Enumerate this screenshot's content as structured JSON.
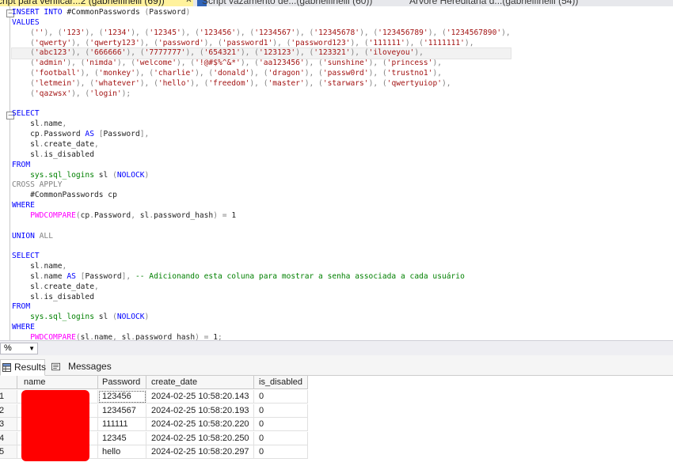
{
  "tabs": [
    {
      "label": "cript para verificar...2 (gabrielfinelli (69))",
      "close": "✕",
      "active": true
    },
    {
      "label": "Script vazamento de...(gabrielfinelli (60))",
      "active": false
    },
    {
      "label": "Árvore Hereditária d...(gabrielfinelli (54))",
      "active": false
    }
  ],
  "editor": {
    "lines": [
      [
        {
          "c": "kw",
          "t": "INSERT INTO "
        },
        {
          "c": "tx",
          "t": "#CommonPasswords "
        },
        {
          "c": "gray",
          "t": "("
        },
        {
          "c": "tx",
          "t": "Password"
        },
        {
          "c": "gray",
          "t": ")"
        }
      ],
      [
        {
          "c": "kw",
          "t": "VALUES"
        }
      ],
      [
        {
          "c": "gray",
          "t": "    ("
        },
        {
          "c": "str",
          "t": "''"
        },
        {
          "c": "gray",
          "t": "), ("
        },
        {
          "c": "str",
          "t": "'123'"
        },
        {
          "c": "gray",
          "t": "), ("
        },
        {
          "c": "str",
          "t": "'1234'"
        },
        {
          "c": "gray",
          "t": "), ("
        },
        {
          "c": "str",
          "t": "'12345'"
        },
        {
          "c": "gray",
          "t": "), ("
        },
        {
          "c": "str",
          "t": "'123456'"
        },
        {
          "c": "gray",
          "t": "), ("
        },
        {
          "c": "str",
          "t": "'1234567'"
        },
        {
          "c": "gray",
          "t": "), ("
        },
        {
          "c": "str",
          "t": "'12345678'"
        },
        {
          "c": "gray",
          "t": "), ("
        },
        {
          "c": "str",
          "t": "'123456789'"
        },
        {
          "c": "gray",
          "t": "), ("
        },
        {
          "c": "str",
          "t": "'1234567890'"
        },
        {
          "c": "gray",
          "t": "),"
        }
      ],
      [
        {
          "c": "gray",
          "t": "    ("
        },
        {
          "c": "str",
          "t": "'qwerty'"
        },
        {
          "c": "gray",
          "t": "), ("
        },
        {
          "c": "str",
          "t": "'qwerty123'"
        },
        {
          "c": "gray",
          "t": "), ("
        },
        {
          "c": "str",
          "t": "'password'"
        },
        {
          "c": "gray",
          "t": "), ("
        },
        {
          "c": "str",
          "t": "'password1'"
        },
        {
          "c": "gray",
          "t": "), ("
        },
        {
          "c": "str",
          "t": "'password123'"
        },
        {
          "c": "gray",
          "t": "), ("
        },
        {
          "c": "str",
          "t": "'111111'"
        },
        {
          "c": "gray",
          "t": "), ("
        },
        {
          "c": "str",
          "t": "'1111111'"
        },
        {
          "c": "gray",
          "t": "),"
        }
      ],
      [
        {
          "c": "gray",
          "t": "    ("
        },
        {
          "c": "str",
          "t": "'abc123'"
        },
        {
          "c": "gray",
          "t": "), ("
        },
        {
          "c": "str",
          "t": "'666666'"
        },
        {
          "c": "gray",
          "t": "), ("
        },
        {
          "c": "str",
          "t": "'7777777'"
        },
        {
          "c": "gray",
          "t": "), ("
        },
        {
          "c": "str",
          "t": "'654321'"
        },
        {
          "c": "gray",
          "t": "), ("
        },
        {
          "c": "str",
          "t": "'123123'"
        },
        {
          "c": "gray",
          "t": "), ("
        },
        {
          "c": "str",
          "t": "'123321'"
        },
        {
          "c": "gray",
          "t": "), ("
        },
        {
          "c": "str",
          "t": "'iloveyou'"
        },
        {
          "c": "gray",
          "t": "),"
        }
      ],
      [
        {
          "c": "gray",
          "t": "    ("
        },
        {
          "c": "str",
          "t": "'admin'"
        },
        {
          "c": "gray",
          "t": "), ("
        },
        {
          "c": "str",
          "t": "'nimda'"
        },
        {
          "c": "gray",
          "t": "), ("
        },
        {
          "c": "str",
          "t": "'welcome'"
        },
        {
          "c": "gray",
          "t": "), ("
        },
        {
          "c": "str",
          "t": "'!@#$%^&*'"
        },
        {
          "c": "gray",
          "t": "), ("
        },
        {
          "c": "str",
          "t": "'aa123456'"
        },
        {
          "c": "gray",
          "t": "), ("
        },
        {
          "c": "str",
          "t": "'sunshine'"
        },
        {
          "c": "gray",
          "t": "), ("
        },
        {
          "c": "str",
          "t": "'princess'"
        },
        {
          "c": "gray",
          "t": "),"
        }
      ],
      [
        {
          "c": "gray",
          "t": "    ("
        },
        {
          "c": "str",
          "t": "'football'"
        },
        {
          "c": "gray",
          "t": "), ("
        },
        {
          "c": "str",
          "t": "'monkey'"
        },
        {
          "c": "gray",
          "t": "), ("
        },
        {
          "c": "str",
          "t": "'charlie'"
        },
        {
          "c": "gray",
          "t": "), ("
        },
        {
          "c": "str",
          "t": "'donald'"
        },
        {
          "c": "gray",
          "t": "), ("
        },
        {
          "c": "str",
          "t": "'dragon'"
        },
        {
          "c": "gray",
          "t": "), ("
        },
        {
          "c": "str",
          "t": "'passw0rd'"
        },
        {
          "c": "gray",
          "t": "), ("
        },
        {
          "c": "str",
          "t": "'trustno1'"
        },
        {
          "c": "gray",
          "t": "),"
        }
      ],
      [
        {
          "c": "gray",
          "t": "    ("
        },
        {
          "c": "str",
          "t": "'letmein'"
        },
        {
          "c": "gray",
          "t": "), ("
        },
        {
          "c": "str",
          "t": "'whatever'"
        },
        {
          "c": "gray",
          "t": "), ("
        },
        {
          "c": "str",
          "t": "'hello'"
        },
        {
          "c": "gray",
          "t": "), ("
        },
        {
          "c": "str",
          "t": "'freedom'"
        },
        {
          "c": "gray",
          "t": "), ("
        },
        {
          "c": "str",
          "t": "'master'"
        },
        {
          "c": "gray",
          "t": "), ("
        },
        {
          "c": "str",
          "t": "'starwars'"
        },
        {
          "c": "gray",
          "t": "), ("
        },
        {
          "c": "str",
          "t": "'qwertyuiop'"
        },
        {
          "c": "gray",
          "t": "),"
        }
      ],
      [
        {
          "c": "gray",
          "t": "    ("
        },
        {
          "c": "str",
          "t": "'qazwsx'"
        },
        {
          "c": "gray",
          "t": "), ("
        },
        {
          "c": "str",
          "t": "'login'"
        },
        {
          "c": "gray",
          "t": ");"
        }
      ],
      [],
      [
        {
          "c": "kw",
          "t": "SELECT"
        }
      ],
      [
        {
          "c": "tx",
          "t": "    sl"
        },
        {
          "c": "gray",
          "t": "."
        },
        {
          "c": "tx",
          "t": "name"
        },
        {
          "c": "gray",
          "t": ","
        }
      ],
      [
        {
          "c": "tx",
          "t": "    cp"
        },
        {
          "c": "gray",
          "t": "."
        },
        {
          "c": "tx",
          "t": "Password "
        },
        {
          "c": "kw",
          "t": "AS "
        },
        {
          "c": "gray",
          "t": "["
        },
        {
          "c": "tx",
          "t": "Password"
        },
        {
          "c": "gray",
          "t": "],"
        }
      ],
      [
        {
          "c": "tx",
          "t": "    sl"
        },
        {
          "c": "gray",
          "t": "."
        },
        {
          "c": "tx",
          "t": "create_date"
        },
        {
          "c": "gray",
          "t": ","
        }
      ],
      [
        {
          "c": "tx",
          "t": "    sl"
        },
        {
          "c": "gray",
          "t": "."
        },
        {
          "c": "tx",
          "t": "is_disabled"
        }
      ],
      [
        {
          "c": "kw",
          "t": "FROM"
        }
      ],
      [
        {
          "c": "tx",
          "t": "    "
        },
        {
          "c": "cm",
          "t": "sys.sql_logins"
        },
        {
          "c": "tx",
          "t": " sl "
        },
        {
          "c": "gray",
          "t": "("
        },
        {
          "c": "kw",
          "t": "NOLOCK"
        },
        {
          "c": "gray",
          "t": ")"
        }
      ],
      [
        {
          "c": "gray",
          "t": "CROSS APPLY"
        }
      ],
      [
        {
          "c": "tx",
          "t": "    #CommonPasswords cp"
        }
      ],
      [
        {
          "c": "kw",
          "t": "WHERE"
        }
      ],
      [
        {
          "c": "tx",
          "t": "    "
        },
        {
          "c": "fn",
          "t": "PWDCOMPARE"
        },
        {
          "c": "gray",
          "t": "("
        },
        {
          "c": "tx",
          "t": "cp"
        },
        {
          "c": "gray",
          "t": "."
        },
        {
          "c": "tx",
          "t": "Password"
        },
        {
          "c": "gray",
          "t": ", "
        },
        {
          "c": "tx",
          "t": "sl"
        },
        {
          "c": "gray",
          "t": "."
        },
        {
          "c": "tx",
          "t": "password_hash"
        },
        {
          "c": "gray",
          "t": ") = "
        },
        {
          "c": "tx",
          "t": "1"
        }
      ],
      [],
      [
        {
          "c": "kw",
          "t": "UNION "
        },
        {
          "c": "gray",
          "t": "ALL"
        }
      ],
      [],
      [
        {
          "c": "kw",
          "t": "SELECT"
        }
      ],
      [
        {
          "c": "tx",
          "t": "    sl"
        },
        {
          "c": "gray",
          "t": "."
        },
        {
          "c": "tx",
          "t": "name"
        },
        {
          "c": "gray",
          "t": ","
        }
      ],
      [
        {
          "c": "tx",
          "t": "    sl"
        },
        {
          "c": "gray",
          "t": "."
        },
        {
          "c": "tx",
          "t": "name "
        },
        {
          "c": "kw",
          "t": "AS "
        },
        {
          "c": "gray",
          "t": "["
        },
        {
          "c": "tx",
          "t": "Password"
        },
        {
          "c": "gray",
          "t": "], "
        },
        {
          "c": "cm",
          "t": "-- Adicionando esta coluna para mostrar a senha associada a cada usuário"
        }
      ],
      [
        {
          "c": "tx",
          "t": "    sl"
        },
        {
          "c": "gray",
          "t": "."
        },
        {
          "c": "tx",
          "t": "create_date"
        },
        {
          "c": "gray",
          "t": ","
        }
      ],
      [
        {
          "c": "tx",
          "t": "    sl"
        },
        {
          "c": "gray",
          "t": "."
        },
        {
          "c": "tx",
          "t": "is_disabled"
        }
      ],
      [
        {
          "c": "kw",
          "t": "FROM"
        }
      ],
      [
        {
          "c": "tx",
          "t": "    "
        },
        {
          "c": "cm",
          "t": "sys.sql_logins"
        },
        {
          "c": "tx",
          "t": " sl "
        },
        {
          "c": "gray",
          "t": "("
        },
        {
          "c": "kw",
          "t": "NOLOCK"
        },
        {
          "c": "gray",
          "t": ")"
        }
      ],
      [
        {
          "c": "kw",
          "t": "WHERE"
        }
      ],
      [
        {
          "c": "tx",
          "t": "    "
        },
        {
          "c": "fn",
          "t": "PWDCOMPARE"
        },
        {
          "c": "gray",
          "t": "("
        },
        {
          "c": "tx",
          "t": "sl"
        },
        {
          "c": "gray",
          "t": "."
        },
        {
          "c": "tx",
          "t": "name"
        },
        {
          "c": "gray",
          "t": ", "
        },
        {
          "c": "tx",
          "t": "sl"
        },
        {
          "c": "gray",
          "t": "."
        },
        {
          "c": "tx",
          "t": "password_hash"
        },
        {
          "c": "gray",
          "t": ") = "
        },
        {
          "c": "tx",
          "t": "1"
        },
        {
          "c": "gray",
          "t": ";"
        }
      ]
    ],
    "highlighted_line": 4,
    "collapse_markers": [
      {
        "line": 0,
        "glyph": "−"
      },
      {
        "line": 10,
        "glyph": "−"
      }
    ]
  },
  "zoom": {
    "value": "%",
    "arrow": "▼"
  },
  "results_tabs": {
    "results_label": "Results",
    "messages_label": "Messages"
  },
  "grid": {
    "columns": [
      "name",
      "Password",
      "create_date",
      "is_disabled"
    ],
    "rows": [
      {
        "num": "1",
        "name": "",
        "password": "123456",
        "create_date": "2024-02-25 10:58:20.143",
        "is_disabled": "0"
      },
      {
        "num": "2",
        "name": "",
        "password": "1234567",
        "create_date": "2024-02-25 10:58:20.193",
        "is_disabled": "0"
      },
      {
        "num": "3",
        "name": "",
        "password": "111111",
        "create_date": "2024-02-25 10:58:20.220",
        "is_disabled": "0"
      },
      {
        "num": "4",
        "name": "",
        "password": "12345",
        "create_date": "2024-02-25 10:58:20.250",
        "is_disabled": "0"
      },
      {
        "num": "5",
        "name": "",
        "password": "hello",
        "create_date": "2024-02-25 10:58:20.297",
        "is_disabled": "0"
      }
    ],
    "redaction_color": "#ff0000"
  }
}
